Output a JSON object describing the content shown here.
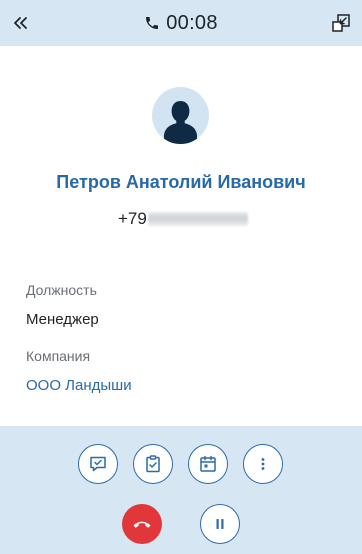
{
  "header": {
    "timer": "00:08",
    "collapse_icon": "double-chevron-left-icon",
    "phone_icon": "phone-icon",
    "minimize_icon": "minimize-window-icon"
  },
  "contact": {
    "avatar_icon": "person-silhouette-icon",
    "name": "Петров Анатолий Иванович",
    "phone_visible": "+79"
  },
  "fields": {
    "position_label": "Должность",
    "position_value": "Менеджер",
    "company_label": "Компания",
    "company_value": "ООО Ландыши"
  },
  "actions": {
    "comment_icon": "chat-bubble-icon",
    "task_icon": "clipboard-check-icon",
    "meeting_icon": "calendar-icon",
    "more_icon": "vertical-dots-icon",
    "hangup_icon": "hang-up-phone-icon",
    "hold_icon": "pause-icon"
  },
  "colors": {
    "panel": "#d6e6f3",
    "accent": "#2869a8",
    "hangup": "#e1373b",
    "avatar_bg": "#d2e4f2",
    "avatar_figure": "#0f2a44"
  }
}
